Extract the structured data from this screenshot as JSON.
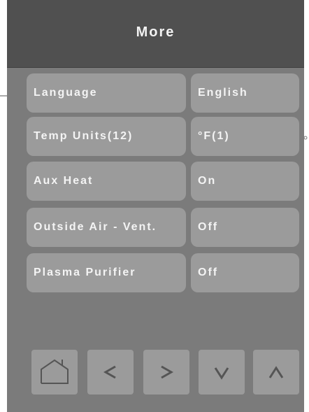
{
  "header": {
    "title": "More"
  },
  "settings": [
    {
      "label": "Language",
      "value": "English"
    },
    {
      "label": "Temp Units(12)",
      "value": "°F(1)"
    },
    {
      "label": "Aux Heat",
      "value": "On"
    },
    {
      "label": "Outside Air - Vent.",
      "value": "Off"
    },
    {
      "label": "Plasma Purifier",
      "value": "Off"
    }
  ],
  "nav": {
    "icons": [
      "home-icon",
      "chevron-left-icon",
      "chevron-right-icon",
      "chevron-down-icon",
      "chevron-up-icon"
    ]
  },
  "colors": {
    "screen_bg": "#7b7b7b",
    "header_bg": "#505050",
    "button_bg": "#9b9b9b",
    "text": "#f4f4f4"
  }
}
